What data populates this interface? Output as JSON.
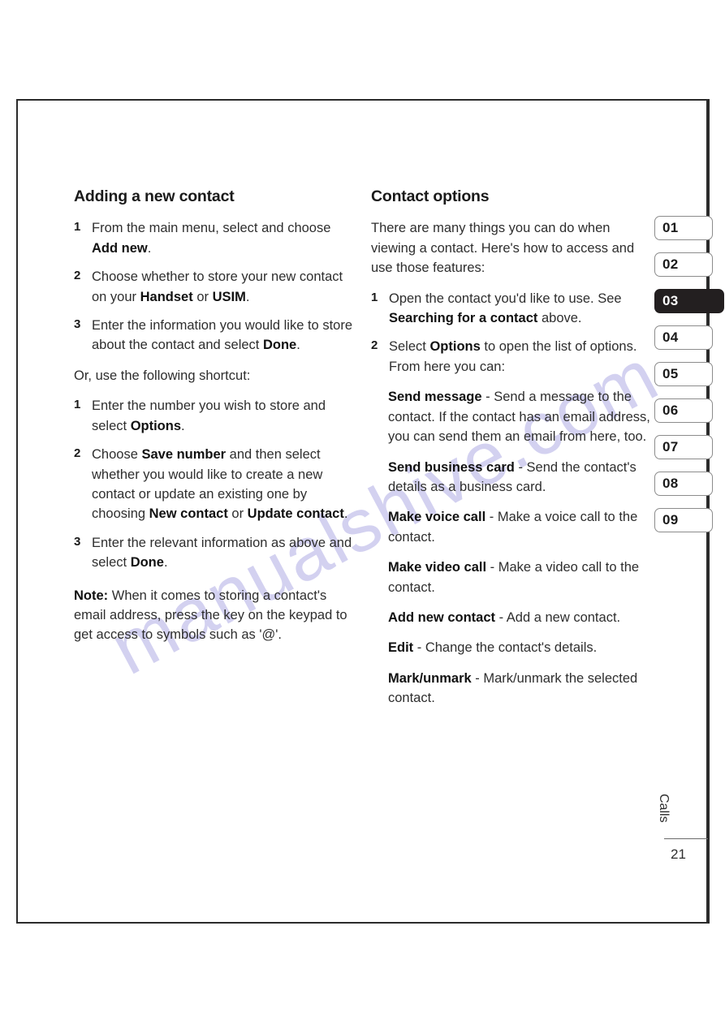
{
  "page": {
    "number": "21",
    "chapter_label": "Calls",
    "watermark": "manualshive.com"
  },
  "left_column": {
    "heading": "Adding a new contact",
    "steps_primary": [
      {
        "num": "1",
        "parts": [
          {
            "text": "From the main menu, select  and choose ",
            "bold": false
          },
          {
            "text": "Add new",
            "bold": true
          },
          {
            "text": ".",
            "bold": false
          }
        ]
      },
      {
        "num": "2",
        "parts": [
          {
            "text": "Choose whether to store your new contact on your ",
            "bold": false
          },
          {
            "text": "Handset",
            "bold": true
          },
          {
            "text": " or ",
            "bold": false
          },
          {
            "text": "USIM",
            "bold": true
          },
          {
            "text": ".",
            "bold": false
          }
        ]
      },
      {
        "num": "3",
        "parts": [
          {
            "text": "Enter the information you would like to store about the contact and select ",
            "bold": false
          },
          {
            "text": "Done",
            "bold": true
          },
          {
            "text": ".",
            "bold": false
          }
        ]
      }
    ],
    "shortcut_intro": "Or, use the following shortcut:",
    "steps_shortcut": [
      {
        "num": "1",
        "parts": [
          {
            "text": "Enter the number you wish to store and select ",
            "bold": false
          },
          {
            "text": "Options",
            "bold": true
          },
          {
            "text": ".",
            "bold": false
          }
        ]
      },
      {
        "num": "2",
        "parts": [
          {
            "text": "Choose ",
            "bold": false
          },
          {
            "text": "Save number",
            "bold": true
          },
          {
            "text": " and then select whether you would like to create a new contact or update an existing one by choosing ",
            "bold": false
          },
          {
            "text": "New contact",
            "bold": true
          },
          {
            "text": " or ",
            "bold": false
          },
          {
            "text": "Update contact",
            "bold": true
          },
          {
            "text": ".",
            "bold": false
          }
        ]
      },
      {
        "num": "3",
        "parts": [
          {
            "text": "Enter the relevant information as above and select ",
            "bold": false
          },
          {
            "text": "Done",
            "bold": true
          },
          {
            "text": ".",
            "bold": false
          }
        ]
      }
    ],
    "note": {
      "parts": [
        {
          "text": "Note:",
          "bold": true
        },
        {
          "text": " When it comes to storing a contact's email address, press the  key on the keypad to get access to symbols such as '@'.",
          "bold": false
        }
      ]
    }
  },
  "right_column": {
    "heading": "Contact options",
    "intro": "There are many things you can do when viewing a contact. Here's how to access and use those features:",
    "steps": [
      {
        "num": "1",
        "parts": [
          {
            "text": "Open the contact you'd like to use. See ",
            "bold": false
          },
          {
            "text": "Searching for a contact",
            "bold": true
          },
          {
            "text": " above.",
            "bold": false
          }
        ]
      },
      {
        "num": "2",
        "parts": [
          {
            "text": "Select ",
            "bold": false
          },
          {
            "text": "Options",
            "bold": true
          },
          {
            "text": " to open the list of options. From here you can:",
            "bold": false
          }
        ]
      }
    ],
    "options": [
      {
        "parts": [
          {
            "text": "Send message",
            "bold": true
          },
          {
            "text": " - Send a message to the contact. If the contact has an email address, you can send them an email from here, too.",
            "bold": false
          }
        ]
      },
      {
        "parts": [
          {
            "text": "Send business card",
            "bold": true
          },
          {
            "text": " - Send the contact's details as a business card.",
            "bold": false
          }
        ]
      },
      {
        "parts": [
          {
            "text": "Make voice call",
            "bold": true
          },
          {
            "text": " - Make a voice call to the contact.",
            "bold": false
          }
        ]
      },
      {
        "parts": [
          {
            "text": "Make video call",
            "bold": true
          },
          {
            "text": " - Make a video call to the contact.",
            "bold": false
          }
        ]
      },
      {
        "parts": [
          {
            "text": "Add new contact",
            "bold": true
          },
          {
            "text": " - Add a new contact.",
            "bold": false
          }
        ]
      },
      {
        "parts": [
          {
            "text": "Edit",
            "bold": true
          },
          {
            "text": " - Change the contact's details.",
            "bold": false
          }
        ]
      },
      {
        "parts": [
          {
            "text": "Mark/unmark",
            "bold": true
          },
          {
            "text": " - Mark/unmark the selected contact.",
            "bold": false
          }
        ]
      }
    ]
  },
  "tab_rail": {
    "active_index": 2,
    "tabs": [
      {
        "label": "01"
      },
      {
        "label": "02"
      },
      {
        "label": "03"
      },
      {
        "label": "04"
      },
      {
        "label": "05"
      },
      {
        "label": "06"
      },
      {
        "label": "07"
      },
      {
        "label": "08"
      },
      {
        "label": "09"
      }
    ]
  },
  "colors": {
    "ink": "#231f20",
    "active_tab_bg": "#231f20",
    "active_tab_text": "#ffffff",
    "watermark": "#b9b6e8"
  }
}
